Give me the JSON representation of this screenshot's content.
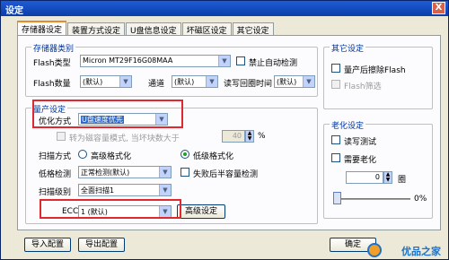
{
  "window": {
    "title": "设定",
    "close_glyph": "X"
  },
  "tabs": [
    {
      "label": "存储器设定",
      "active": true
    },
    {
      "label": "装置方式设定",
      "active": false
    },
    {
      "label": "U盘信息设定",
      "active": false
    },
    {
      "label": "坏磁区设定",
      "active": false
    },
    {
      "label": "其它设定",
      "active": false
    }
  ],
  "storage_group": {
    "title": "存储器类别",
    "flash_type_label": "Flash类型",
    "flash_type_value": "Micron MT29F16G08MAA",
    "disable_auto_detect": "禁止自动检测",
    "flash_count_label": "Flash数量",
    "flash_count_value": "(默认)",
    "channel_label": "通道",
    "channel_value": "(默认)",
    "read_write_time_label": "读写回圈时间",
    "read_write_time_value": "(默认)"
  },
  "production_group": {
    "title": "量产设定",
    "optimize_label": "优化方式",
    "optimize_value": "U盘速度优先",
    "conversion_label": "转为磁容量模式, 当坏块数大于",
    "conversion_value": "40",
    "conversion_unit": "%",
    "scan_mode_label": "扫描方式",
    "scan_high": "高级格式化",
    "scan_low": "低级格式化",
    "low_detect_label": "低格检测",
    "low_detect_value": "正常检测(默认)",
    "fail_half_label": "失败后半容量检测",
    "scan_level_label": "扫描级别",
    "scan_level_value": "全面扫描1",
    "ecc_label": "ECC",
    "ecc_value": "1 (默认)",
    "advanced_button": "高级设定"
  },
  "other_group": {
    "title": "其它设定",
    "erase_after_production": "量产后擦除Flash",
    "flash_filter": "Flash筛选"
  },
  "aging_group": {
    "title": "老化设定",
    "read_write_test": "读写测试",
    "need_aging": "需要老化",
    "cycles_value": "0",
    "cycles_unit": "圈",
    "progress_label": "0%"
  },
  "footer": {
    "import_button": "导入配置",
    "export_button": "导出配置",
    "ok_button": "确定",
    "watermark": "优品之家"
  },
  "colors": {
    "highlight_red": "#e0282e",
    "title_blue": "#0a3fa8",
    "selection_blue": "#316ac5"
  }
}
